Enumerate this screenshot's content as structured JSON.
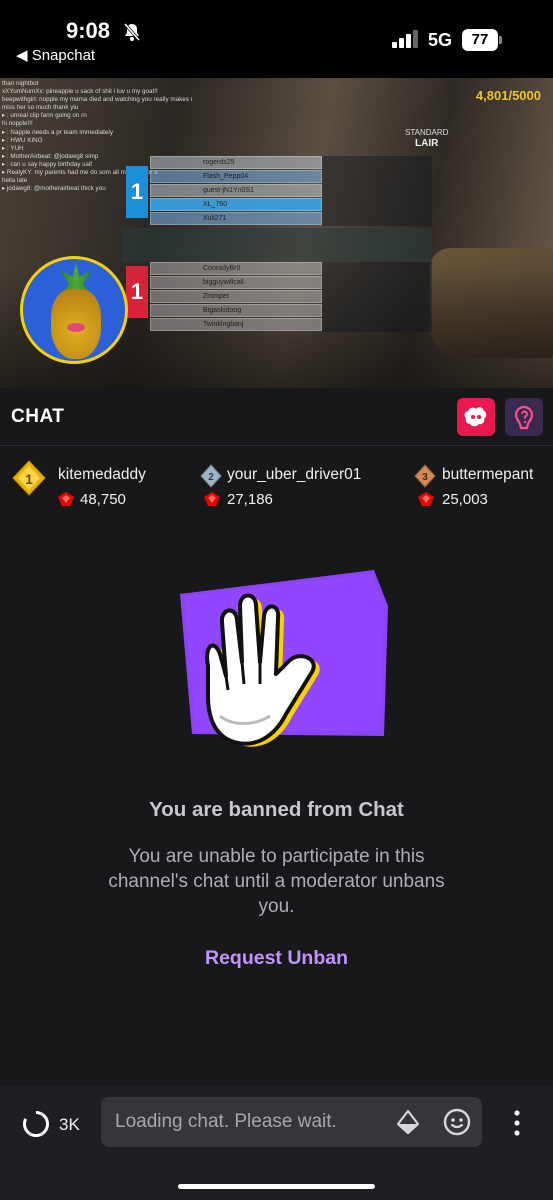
{
  "status_bar": {
    "time": "9:08",
    "back_app": "◀ Snapchat",
    "network": "5G",
    "battery": "77"
  },
  "video": {
    "score_total": "4,801/5000",
    "mode": "STANDARD",
    "map": "LAIR",
    "stream_chat": [
      "than nightbot",
      "xXYumNumXx: pineapple u sack of shit i luv u my goat!!",
      "beepwithgirl: nopple my mama died and watching you really makes me",
      "miss her so much thank yiu",
      "▸ : unreal clip farm going on rn",
      "hi nopple!!!",
      "▸ : Napple needs a pr team immediately",
      "▸ : HWU KING",
      "▸ : YUH",
      "▸ : MotherAirbeat: @jodawg8 simp",
      "▸ : can u say happy birthday saif",
      "▸ RealyKY: my parents had me do som all morning for a",
      "hella late",
      "▸ jodawg8: @motherairbeat thick you"
    ],
    "scoreboard_rows_top": [
      "rogerds25",
      "Flash_Pepp04",
      "guest-jN1Yn0S1",
      "XL_760",
      "Xuli271"
    ],
    "scoreboard_rows_bottom": [
      "ConradyBr0",
      "bigguywillcall",
      "Zmmper",
      "Bigaskidoog",
      "Twinklngbanj"
    ],
    "team_blue_score": "1",
    "team_red_score": "1"
  },
  "chat": {
    "title": "CHAT",
    "leaders": [
      {
        "rank": "1",
        "name": "kitemedaddy",
        "points": "48,750"
      },
      {
        "rank": "2",
        "name": "your_uber_driver01",
        "points": "27,186"
      },
      {
        "rank": "3",
        "name": "buttermepant",
        "points": "25,003"
      }
    ],
    "ban_title": "You are banned from Chat",
    "ban_text": "You are unable to participate in this channel's chat until a moderator unbans you.",
    "unban_label": "Request Unban"
  },
  "bottom_bar": {
    "viewer_count": "3K",
    "input_placeholder": "Loading chat. Please wait."
  },
  "colors": {
    "accent": "#bf94ff",
    "ban_art_purple": "#8b44f5",
    "badge_gold": "#e8b400",
    "gem_red": "#eb0400",
    "snap_pink": "#e9194f"
  },
  "icons": [
    "bell-off-icon",
    "signal-icon",
    "battery-icon",
    "gold-rank-badge-icon",
    "silver-rank-badge-icon",
    "bronze-rank-badge-icon",
    "channel-points-icon",
    "hype-icon",
    "prediction-icon",
    "viewers-ring-icon",
    "bits-diamond-icon",
    "emoji-icon",
    "more-vertical-icon",
    "raised-hand-icon"
  ]
}
